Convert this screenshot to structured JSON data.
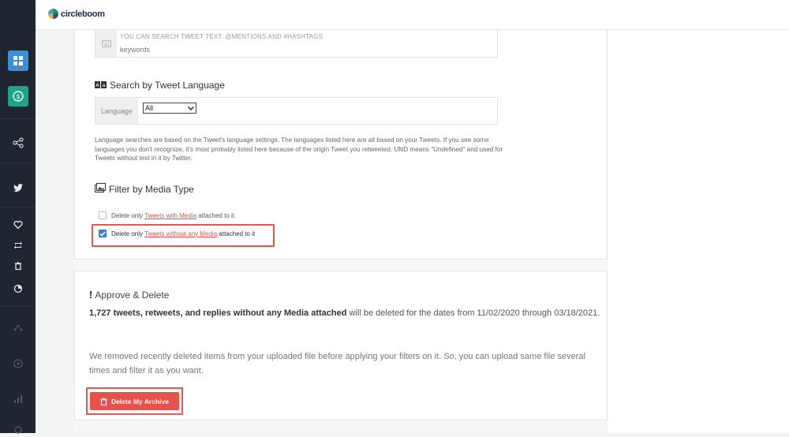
{
  "brand": {
    "name": "circleboom"
  },
  "sidebar": {
    "items": [
      {
        "icon": "dashboard-icon",
        "color": "#3b8fd9"
      },
      {
        "icon": "dollar-icon",
        "color": "#1fa48c"
      },
      {
        "icon": "share-icon"
      },
      {
        "icon": "twitter-icon"
      },
      {
        "icon": "heart-icon"
      },
      {
        "icon": "retweet-icon"
      },
      {
        "icon": "trash-icon"
      },
      {
        "icon": "pie-icon"
      },
      {
        "icon": "network-icon"
      },
      {
        "icon": "circle-icon"
      },
      {
        "icon": "chart-icon"
      }
    ]
  },
  "keywords": {
    "hint": "YOU CAN SEARCH TWEET TEXT, @MENTIONS AND #HASHTAGS",
    "placeholder": "keywords"
  },
  "language": {
    "title": "Search by Tweet Language",
    "label": "Language",
    "selected": "All",
    "note": "Language searches are based on the Tweet's language settings. The languages listed here are all based on your Tweets. If you see some languages you don't recognize, it's most probably listed here because of the origin Tweet you retweeted. UND means \"Undefined\" and used for Tweets without text in it by Twitter."
  },
  "media": {
    "title": "Filter by Media Type",
    "options": [
      {
        "prefix": "Delete only",
        "link": "Tweets with Media",
        "suffix": "attached to it",
        "checked": false
      },
      {
        "prefix": "Delete only",
        "link": "Tweets without any Media",
        "suffix": "attached to it",
        "checked": true
      }
    ]
  },
  "approve": {
    "title": "Approve & Delete",
    "count": "1,727",
    "summary_bold": "tweets, retweets, and replies without any Media attached",
    "summary_rest": "will be deleted for the dates from 11/02/2020 through 03/18/2021.",
    "removed_note": "We removed recently deleted items from your uploaded file before applying your filters on it. So, you can upload same file several times and filter it as you want.",
    "button_label": "Delete My Archive"
  },
  "colors": {
    "accent_red": "#e8524a",
    "checkbox_blue": "#3b82d6",
    "sidebar_bg": "#1f2630"
  }
}
